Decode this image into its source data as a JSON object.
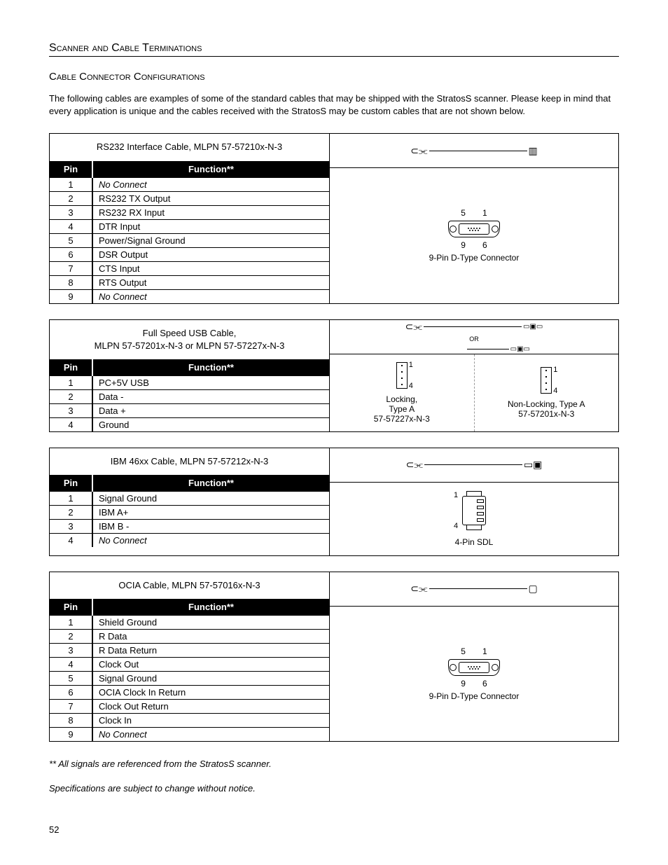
{
  "section_title": "Scanner and Cable Terminations",
  "sub_title": "Cable Connector Configurations",
  "intro": "The following cables are examples of some of the standard cables that may be shipped with the StratosS scanner. Please keep in mind that every application is unique and the cables received with the StratosS may be custom cables that are not shown below.",
  "headers": {
    "pin": "Pin",
    "function": "Function**"
  },
  "cable1": {
    "title_pre": "RS232 Interface Cable, ",
    "title_mlpn": "MLPN",
    "title_post": " 57-57210x-N-3",
    "rows": [
      {
        "pin": "1",
        "fn": "No Connect",
        "italic": true
      },
      {
        "pin": "2",
        "fn": "RS232 TX Output"
      },
      {
        "pin": "3",
        "fn": "RS232 RX Input"
      },
      {
        "pin": "4",
        "fn": "DTR Input"
      },
      {
        "pin": "5",
        "fn": "Power/Signal Ground"
      },
      {
        "pin": "6",
        "fn": "DSR Output"
      },
      {
        "pin": "7",
        "fn": "CTS Input"
      },
      {
        "pin": "8",
        "fn": "RTS Output"
      },
      {
        "pin": "9",
        "fn": "No Connect",
        "italic": true
      }
    ],
    "diag_label": "9-Pin D-Type Connector",
    "pin5": "5",
    "pin1": "1",
    "pin9": "9",
    "pin6": "6"
  },
  "cable2": {
    "title_line1": "Full Speed USB Cable,",
    "title_mlpn": "MLPN",
    "title_pn1": " 57-57201x-N-3 or ",
    "title_pn2": " 57-57227x-N-3",
    "rows": [
      {
        "pin": "1",
        "fn": "PC+5V USB"
      },
      {
        "pin": "2",
        "fn": "Data -"
      },
      {
        "pin": "3",
        "fn": "Data +"
      },
      {
        "pin": "4",
        "fn": "Ground"
      }
    ],
    "left_caption1": "Locking,",
    "left_caption2": "Type A",
    "left_caption3": "57-57227x-N-3",
    "right_caption1": "Non-Locking, Type A",
    "right_caption2": "57-57201x-N-3",
    "lbl1": "1",
    "lbl4": "4",
    "or": "OR"
  },
  "cable3": {
    "title_pre": "IBM 46xx Cable, ",
    "title_mlpn": "MLPN",
    "title_post": " 57-57212x-N-3",
    "rows": [
      {
        "pin": "1",
        "fn": "Signal Ground"
      },
      {
        "pin": "2",
        "fn": "IBM A+"
      },
      {
        "pin": "3",
        "fn": "IBM B -"
      },
      {
        "pin": "4",
        "fn": "No Connect",
        "italic": true
      }
    ],
    "diag_label": "4-Pin SDL",
    "lbl1": "1",
    "lbl4": "4"
  },
  "cable4": {
    "title_pre": "OCIA Cable, ",
    "title_mlpn": "MLPN",
    "title_post": " 57-57016x-N-3",
    "rows": [
      {
        "pin": "1",
        "fn": "Shield Ground"
      },
      {
        "pin": "2",
        "fn": "R Data"
      },
      {
        "pin": "3",
        "fn": "R Data Return"
      },
      {
        "pin": "4",
        "fn": "Clock Out"
      },
      {
        "pin": "5",
        "fn": "Signal Ground"
      },
      {
        "pin": "6",
        "fn": "OCIA Clock In Return"
      },
      {
        "pin": "7",
        "fn": "Clock Out Return"
      },
      {
        "pin": "8",
        "fn": "Clock In"
      },
      {
        "pin": "9",
        "fn": "No Connect",
        "italic": true
      }
    ],
    "diag_label": "9-Pin D-Type Connector",
    "pin5": "5",
    "pin1": "1",
    "pin9": "9",
    "pin6": "6"
  },
  "foot1": "** All signals are referenced from the StratosS scanner.",
  "foot2": "Specifications are subject to change without notice.",
  "page": "52"
}
